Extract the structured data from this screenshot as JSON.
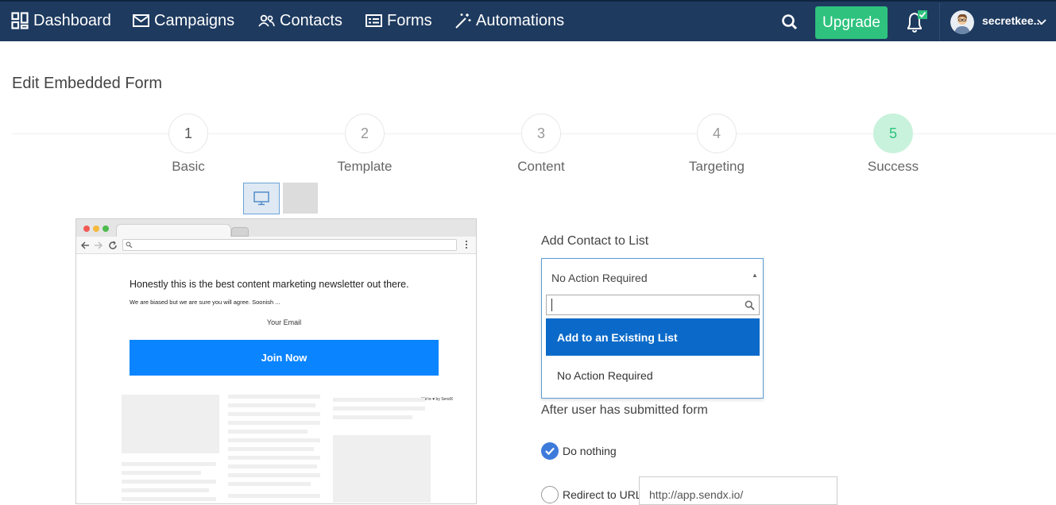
{
  "nav": {
    "dashboard": "Dashboard",
    "campaigns": "Campaigns",
    "contacts": "Contacts",
    "forms": "Forms",
    "automations": "Automations",
    "upgrade": "Upgrade",
    "username": "secretkee..."
  },
  "page": {
    "title": "Edit Embedded Form"
  },
  "steps": [
    {
      "number": "1",
      "label": "Basic"
    },
    {
      "number": "2",
      "label": "Template"
    },
    {
      "number": "3",
      "label": "Content"
    },
    {
      "number": "4",
      "label": "Targeting"
    },
    {
      "number": "5",
      "label": "Success"
    }
  ],
  "preview": {
    "heading": "Honestly this is the best content marketing newsletter out there.",
    "subtext": "We are biased but we are sure you will agree. Soonish ...",
    "email_label": "Your Email",
    "button": "Join Now",
    "credit": "We're ♥ by SendX"
  },
  "list_section": {
    "label": "Add Contact to List",
    "selected": "No Action Required",
    "search_value": "",
    "options": [
      "Add to an Existing List",
      "No Action Required"
    ]
  },
  "after_submit": {
    "label": "After user has submitted form",
    "do_nothing": "Do nothing",
    "redirect": "Redirect to URL",
    "url_value": "http://app.sendx.io/"
  },
  "colors": {
    "topbar": "#1e3a5f",
    "upgrade": "#2ec27e",
    "active_step": "#c8f2dc",
    "highlight": "#0b6ac9",
    "preview_button": "#0a84ff"
  }
}
